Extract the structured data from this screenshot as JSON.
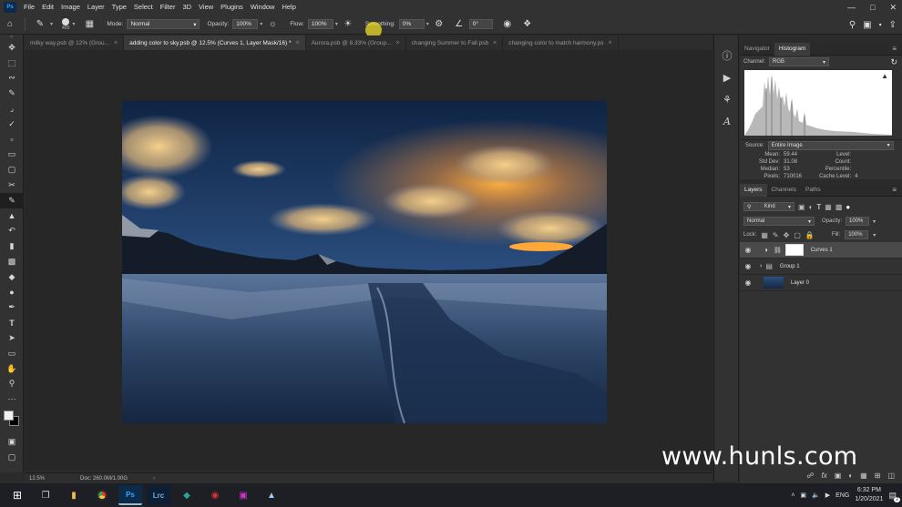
{
  "menu": {
    "logo": "Ps",
    "items": [
      "File",
      "Edit",
      "Image",
      "Layer",
      "Type",
      "Select",
      "Filter",
      "3D",
      "View",
      "Plugins",
      "Window",
      "Help"
    ]
  },
  "options": {
    "brush_size": "400",
    "mode_label": "Mode:",
    "mode_value": "Normal",
    "opacity_label": "Opacity:",
    "opacity_value": "100%",
    "flow_label": "Flow:",
    "flow_value": "100%",
    "smoothing_label": "Smoothing:",
    "smoothing_value": "0%",
    "angle_value": "0°"
  },
  "tabs": [
    {
      "label": "milky way.psb @ 12% (Grou...",
      "active": false
    },
    {
      "label": "adding color to sky.psb @ 12.5% (Curves 1, Layer Mask/16) *",
      "active": true
    },
    {
      "label": "Aurora.psb @ 8.33% (Group...",
      "active": false
    },
    {
      "label": "changing Summer to Fall.psb",
      "active": false
    },
    {
      "label": "changing color to match harmony.ps",
      "active": false
    }
  ],
  "status": {
    "zoom": "12.5%",
    "doc": "Doc: 260.0M/1.00G"
  },
  "histogram_panel": {
    "tabs": [
      "Navigator",
      "Histogram"
    ],
    "active_tab": "Histogram",
    "channel_label": "Channel:",
    "channel_value": "RGB",
    "source_label": "Source:",
    "source_value": "Entire Image",
    "stats_left": [
      {
        "k": "Mean:",
        "v": "59.44"
      },
      {
        "k": "Std Dev:",
        "v": "31.08"
      },
      {
        "k": "Median:",
        "v": "53"
      },
      {
        "k": "Pixels:",
        "v": "710016"
      }
    ],
    "stats_right": [
      {
        "k": "Level:",
        "v": ""
      },
      {
        "k": "Count:",
        "v": ""
      },
      {
        "k": "Percentile:",
        "v": ""
      },
      {
        "k": "Cache Level:",
        "v": "4"
      }
    ]
  },
  "layers_panel": {
    "tabs": [
      "Layers",
      "Channels",
      "Paths"
    ],
    "active_tab": "Layers",
    "kind_value": "Kind",
    "blend_value": "Normal",
    "opacity_label": "Opacity:",
    "opacity_value": "100%",
    "lock_label": "Lock:",
    "fill_label": "Fill:",
    "fill_value": "100%",
    "layers": [
      {
        "name": "Curves 1",
        "selected": true
      },
      {
        "name": "Group 1",
        "selected": false
      },
      {
        "name": "Layer 0",
        "selected": false
      }
    ]
  },
  "taskbar": {
    "lang": "ENG",
    "time": "6:32 PM",
    "date": "1/20/2021",
    "notification_count": "2",
    "lrc_label": "Lrc",
    "ps_label": "Ps"
  },
  "watermark": "www.hunls.com",
  "colors": {
    "accent": "#31a8ff",
    "panel": "#323232",
    "canvas": "#272727"
  }
}
